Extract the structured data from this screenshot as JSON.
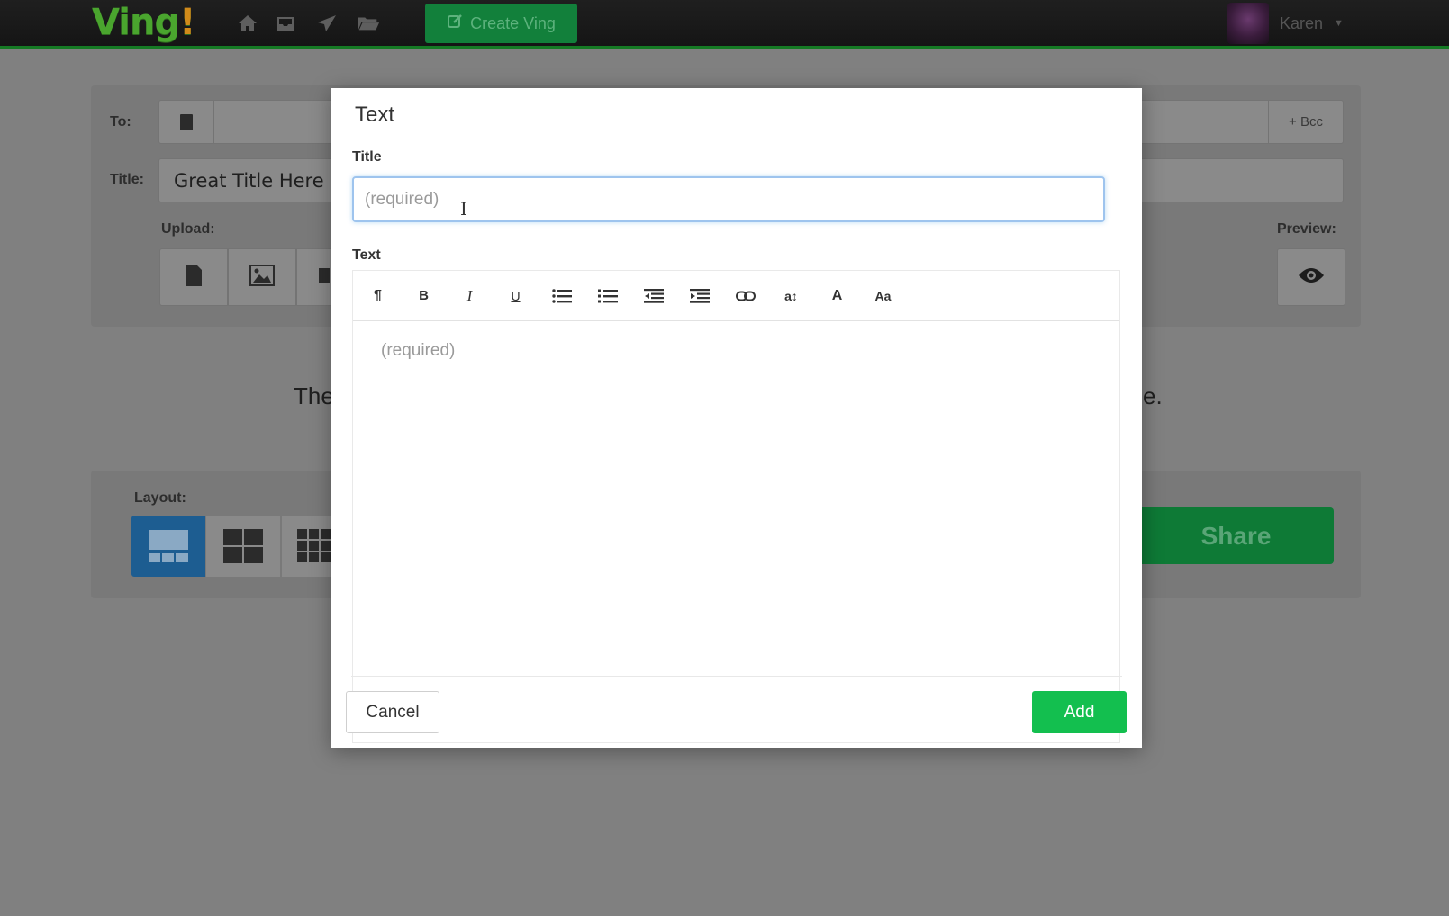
{
  "app": {
    "logo_text": "Ving",
    "logo_mark": "!",
    "nav_icons": [
      "home-icon",
      "inbox-icon",
      "send-icon",
      "folder-icon"
    ],
    "create_button_label": "Create Ving",
    "user_name": "Karen",
    "user_menu_icon": "caret-down-icon"
  },
  "composer": {
    "to_label": "To:",
    "bcc_label": "+ Bcc",
    "title_label": "Title:",
    "title_value": "Great Title Here",
    "upload_label": "Upload:",
    "upload_icons": [
      "document-icon",
      "image-icon",
      "video-icon"
    ],
    "preview_label": "Preview:",
    "preview_icon": "eye-icon",
    "placeholder_text_left": "The",
    "placeholder_text_right": "e.",
    "layout_label": "Layout:",
    "layout_options": [
      "layout-single",
      "layout-2x2",
      "layout-3x3"
    ],
    "share_label": "Share"
  },
  "modal": {
    "title": "Text",
    "title_field_label": "Title",
    "title_placeholder": "(required)",
    "text_field_label": "Text",
    "text_placeholder": "(required)",
    "toolbar": [
      {
        "name": "paragraph",
        "glyph": "¶"
      },
      {
        "name": "bold",
        "glyph": "B"
      },
      {
        "name": "italic",
        "glyph": "I"
      },
      {
        "name": "underline",
        "glyph": "U"
      },
      {
        "name": "unordered-list",
        "glyph": ""
      },
      {
        "name": "ordered-list",
        "glyph": ""
      },
      {
        "name": "outdent",
        "glyph": ""
      },
      {
        "name": "indent",
        "glyph": ""
      },
      {
        "name": "link",
        "glyph": ""
      },
      {
        "name": "font-size",
        "glyph": "a↕"
      },
      {
        "name": "font-color",
        "glyph": "A"
      },
      {
        "name": "font-family",
        "glyph": "Aa"
      }
    ],
    "cancel_label": "Cancel",
    "add_label": "Add"
  },
  "colors": {
    "brand_green": "#13bf4f",
    "topbar_border": "#157a24",
    "overlay_bg": "#808080",
    "layout_selected": "#1d5d91"
  }
}
